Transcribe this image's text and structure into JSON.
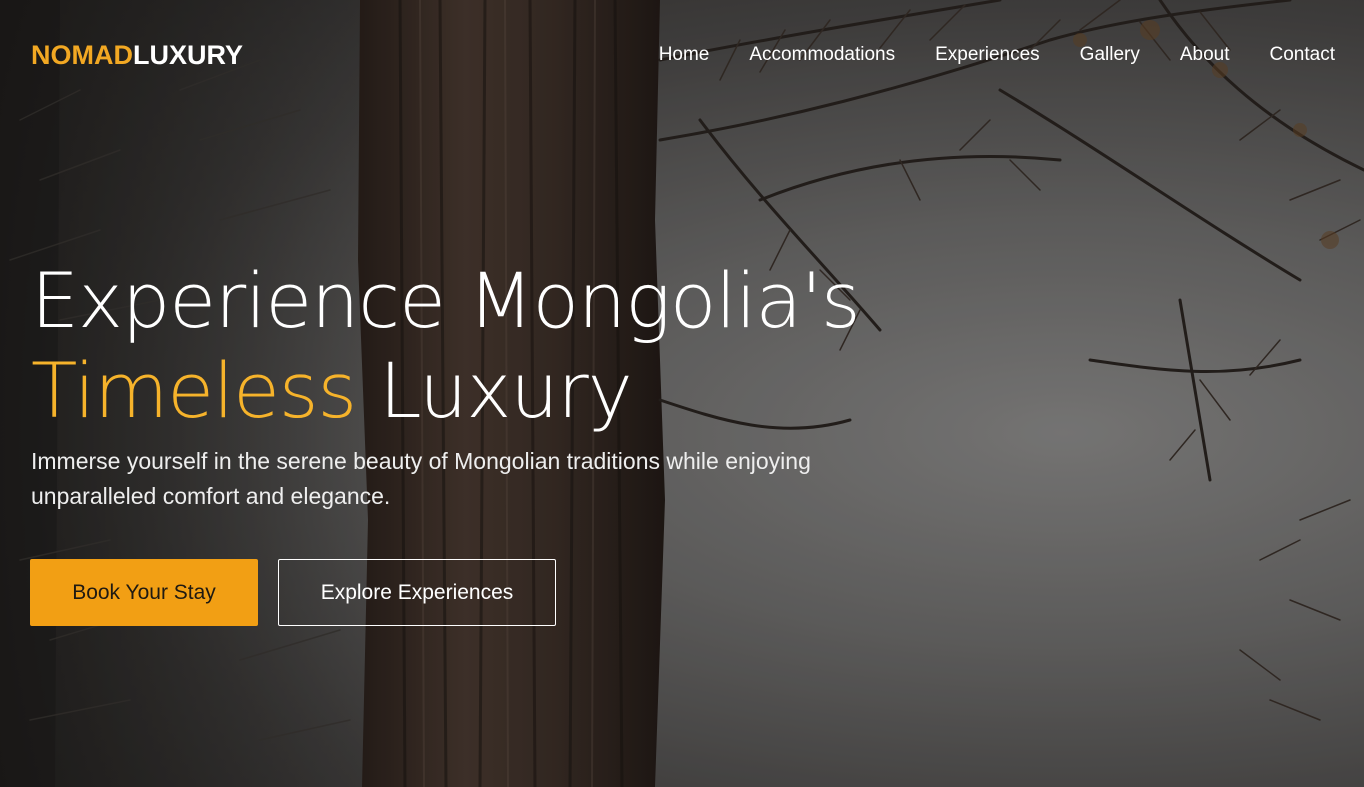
{
  "brand": {
    "name_accent": "NOMAD",
    "name_rest": "LUXURY",
    "accent_color": "#f2a823"
  },
  "nav": {
    "items": [
      {
        "label": "Home"
      },
      {
        "label": "Accommodations"
      },
      {
        "label": "Experiences"
      },
      {
        "label": "Gallery"
      },
      {
        "label": "About"
      },
      {
        "label": "Contact"
      }
    ]
  },
  "hero": {
    "headline_line1": "Experience Mongolia's",
    "headline_highlight": "Timeless",
    "headline_line2_rest": " Luxury",
    "subtitle": "Immerse yourself in the serene beauty of Mongolian traditions while enjoying unparalleled comfort and elegance.",
    "background_image": "forest-trees-sky-photo",
    "highlight_color": "#f6b32b"
  },
  "buttons": {
    "primary_label": "Book Your Stay",
    "secondary_label": "Explore Experiences",
    "primary_color": "#f29f14"
  }
}
